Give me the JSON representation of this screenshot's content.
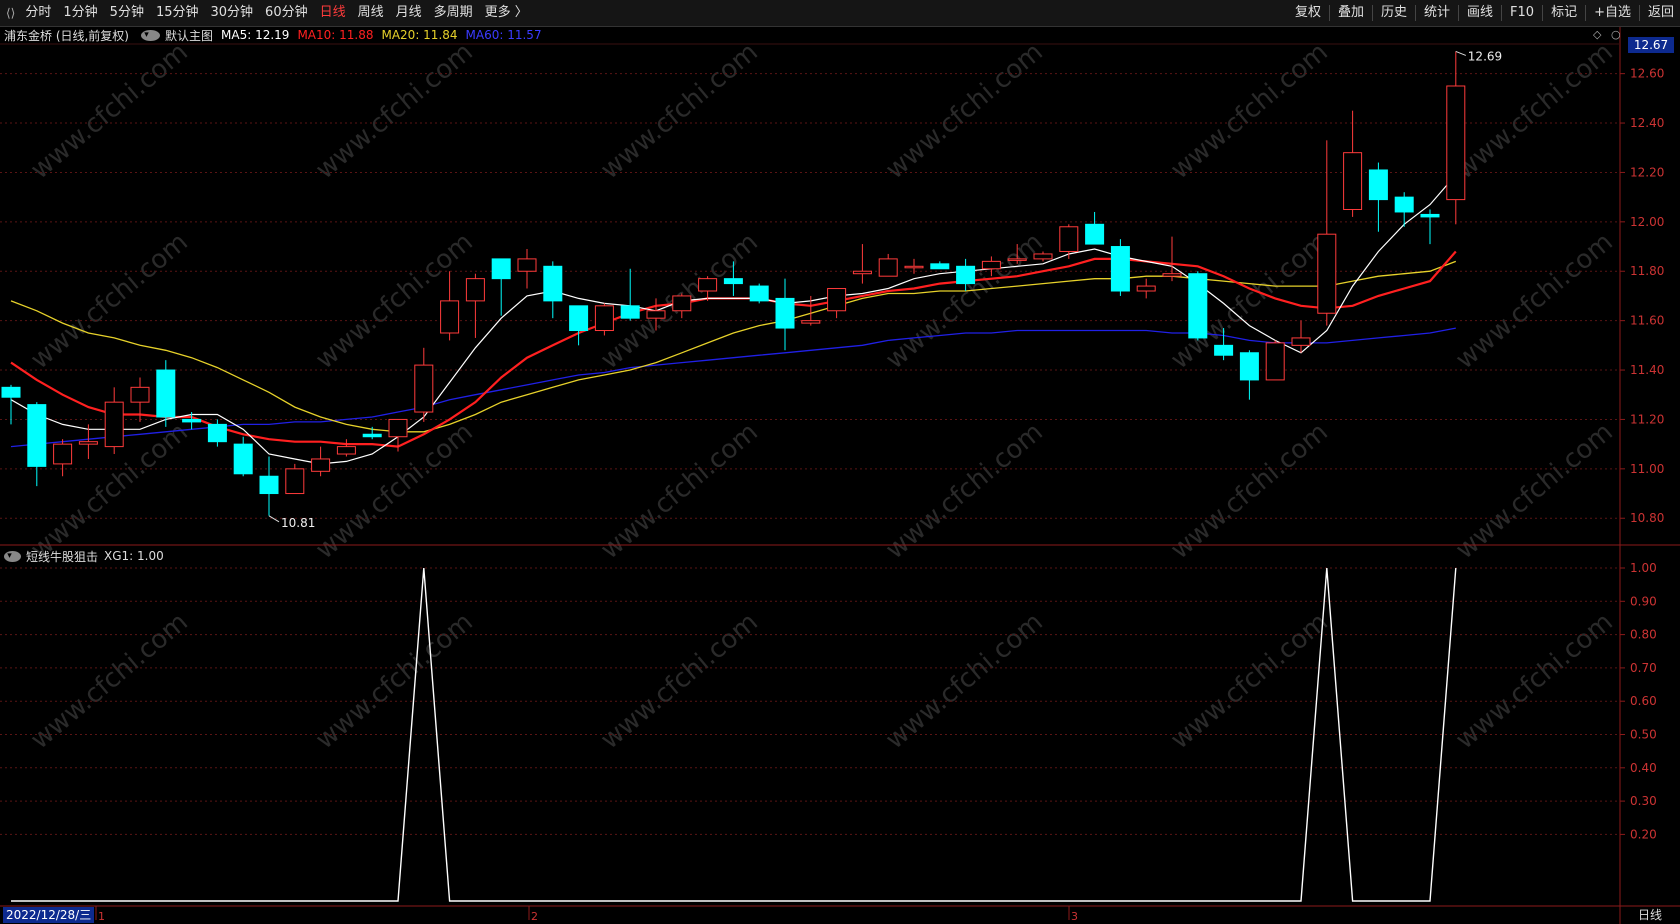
{
  "toolbar": {
    "periods": [
      "分时",
      "1分钟",
      "5分钟",
      "15分钟",
      "30分钟",
      "60分钟",
      "日线",
      "周线",
      "月线",
      "多周期",
      "更多 〉"
    ],
    "active_period": "日线",
    "tools": [
      "复权",
      "叠加",
      "历史",
      "统计",
      "画线",
      "F10",
      "标记",
      "+自选",
      "返回"
    ]
  },
  "main": {
    "stock_title": "浦东金桥 (日线,前复权)",
    "template": "默认主图",
    "ma5": "MA5: 12.19",
    "ma10": "MA10: 11.88",
    "ma20": "MA20: 11.84",
    "ma60": "MA60: 11.57",
    "last_price": "12.67",
    "high_label": "12.69",
    "low_label": "10.81",
    "colors": {
      "up": "#ff3b3b",
      "down": "#00ffff",
      "ma5": "#ffffff",
      "ma10": "#ff2020",
      "ma20": "#e6d12a",
      "ma60": "#2020e6"
    }
  },
  "sub": {
    "indicator": "短线牛股狙击",
    "xg1": "XG1: 1.00"
  },
  "footer": {
    "date": "2022/12/28/三",
    "period": "日线",
    "month_marks": [
      "1",
      "2",
      "3"
    ]
  },
  "watermark": "www.cfchi.com",
  "chart_data": [
    {
      "type": "candlestick",
      "title": "浦东金桥 (日线,前复权)",
      "ylim": [
        10.72,
        12.72
      ],
      "y_ticks": [
        10.8,
        11.0,
        11.2,
        11.4,
        11.6,
        11.8,
        12.0,
        12.2,
        12.4,
        12.6
      ],
      "candles": [
        {
          "o": 11.33,
          "h": 11.34,
          "l": 11.18,
          "c": 11.29
        },
        {
          "o": 11.26,
          "h": 11.27,
          "l": 10.93,
          "c": 11.01
        },
        {
          "o": 11.02,
          "h": 11.12,
          "l": 10.97,
          "c": 11.1
        },
        {
          "o": 11.1,
          "h": 11.18,
          "l": 11.04,
          "c": 11.11
        },
        {
          "o": 11.09,
          "h": 11.33,
          "l": 11.06,
          "c": 11.27
        },
        {
          "o": 11.27,
          "h": 11.37,
          "l": 11.19,
          "c": 11.33
        },
        {
          "o": 11.4,
          "h": 11.44,
          "l": 11.17,
          "c": 11.21
        },
        {
          "o": 11.2,
          "h": 11.23,
          "l": 11.16,
          "c": 11.19
        },
        {
          "o": 11.18,
          "h": 11.2,
          "l": 11.09,
          "c": 11.11
        },
        {
          "o": 11.1,
          "h": 11.13,
          "l": 10.97,
          "c": 10.98
        },
        {
          "o": 10.97,
          "h": 11.05,
          "l": 10.81,
          "c": 10.9
        },
        {
          "o": 10.9,
          "h": 11.02,
          "l": 10.9,
          "c": 11.0
        },
        {
          "o": 10.99,
          "h": 11.09,
          "l": 10.97,
          "c": 11.04
        },
        {
          "o": 11.06,
          "h": 11.12,
          "l": 11.05,
          "c": 11.09
        },
        {
          "o": 11.14,
          "h": 11.17,
          "l": 11.12,
          "c": 11.13
        },
        {
          "o": 11.13,
          "h": 11.2,
          "l": 11.07,
          "c": 11.2
        },
        {
          "o": 11.23,
          "h": 11.49,
          "l": 11.19,
          "c": 11.42
        },
        {
          "o": 11.55,
          "h": 11.8,
          "l": 11.52,
          "c": 11.68
        },
        {
          "o": 11.68,
          "h": 11.79,
          "l": 11.53,
          "c": 11.77
        },
        {
          "o": 11.85,
          "h": 11.85,
          "l": 11.62,
          "c": 11.77
        },
        {
          "o": 11.8,
          "h": 11.89,
          "l": 11.73,
          "c": 11.85
        },
        {
          "o": 11.82,
          "h": 11.84,
          "l": 11.61,
          "c": 11.68
        },
        {
          "o": 11.66,
          "h": 11.66,
          "l": 11.5,
          "c": 11.56
        },
        {
          "o": 11.56,
          "h": 11.67,
          "l": 11.54,
          "c": 11.66
        },
        {
          "o": 11.66,
          "h": 11.81,
          "l": 11.6,
          "c": 11.61
        },
        {
          "o": 11.61,
          "h": 11.69,
          "l": 11.56,
          "c": 11.64
        },
        {
          "o": 11.64,
          "h": 11.71,
          "l": 11.61,
          "c": 11.7
        },
        {
          "o": 11.72,
          "h": 11.78,
          "l": 11.68,
          "c": 11.77
        },
        {
          "o": 11.77,
          "h": 11.84,
          "l": 11.7,
          "c": 11.75
        },
        {
          "o": 11.74,
          "h": 11.75,
          "l": 11.67,
          "c": 11.68
        },
        {
          "o": 11.69,
          "h": 11.77,
          "l": 11.48,
          "c": 11.57
        },
        {
          "o": 11.59,
          "h": 11.7,
          "l": 11.58,
          "c": 11.6
        },
        {
          "o": 11.64,
          "h": 11.72,
          "l": 11.61,
          "c": 11.73
        },
        {
          "o": 11.79,
          "h": 11.91,
          "l": 11.75,
          "c": 11.8
        },
        {
          "o": 11.78,
          "h": 11.87,
          "l": 11.78,
          "c": 11.85
        },
        {
          "o": 11.82,
          "h": 11.85,
          "l": 11.79,
          "c": 11.82
        },
        {
          "o": 11.83,
          "h": 11.84,
          "l": 11.82,
          "c": 11.81
        },
        {
          "o": 11.82,
          "h": 11.85,
          "l": 11.72,
          "c": 11.75
        },
        {
          "o": 11.81,
          "h": 11.86,
          "l": 11.78,
          "c": 11.84
        },
        {
          "o": 11.85,
          "h": 11.91,
          "l": 11.83,
          "c": 11.85
        },
        {
          "o": 11.85,
          "h": 11.88,
          "l": 11.84,
          "c": 11.87
        },
        {
          "o": 11.88,
          "h": 11.99,
          "l": 11.85,
          "c": 11.98
        },
        {
          "o": 11.99,
          "h": 12.04,
          "l": 11.91,
          "c": 11.91
        },
        {
          "o": 11.9,
          "h": 11.93,
          "l": 11.7,
          "c": 11.72
        },
        {
          "o": 11.72,
          "h": 11.77,
          "l": 11.69,
          "c": 11.74
        },
        {
          "o": 11.78,
          "h": 11.94,
          "l": 11.76,
          "c": 11.79
        },
        {
          "o": 11.79,
          "h": 11.8,
          "l": 11.52,
          "c": 11.53
        },
        {
          "o": 11.5,
          "h": 11.57,
          "l": 11.44,
          "c": 11.46
        },
        {
          "o": 11.47,
          "h": 11.48,
          "l": 11.28,
          "c": 11.36
        },
        {
          "o": 11.36,
          "h": 11.52,
          "l": 11.36,
          "c": 11.51
        },
        {
          "o": 11.5,
          "h": 11.6,
          "l": 11.47,
          "c": 11.53
        },
        {
          "o": 11.63,
          "h": 12.33,
          "l": 11.58,
          "c": 11.95
        },
        {
          "o": 12.05,
          "h": 12.45,
          "l": 12.02,
          "c": 12.28
        },
        {
          "o": 12.21,
          "h": 12.24,
          "l": 11.96,
          "c": 12.09
        },
        {
          "o": 12.1,
          "h": 12.12,
          "l": 11.98,
          "c": 12.04
        },
        {
          "o": 12.03,
          "h": 12.05,
          "l": 11.91,
          "c": 12.02
        },
        {
          "o": 12.09,
          "h": 12.69,
          "l": 11.99,
          "c": 12.55
        }
      ],
      "ma5": [
        11.28,
        11.22,
        11.18,
        11.16,
        11.16,
        11.16,
        11.2,
        11.22,
        11.22,
        11.16,
        11.06,
        11.04,
        11.02,
        11.03,
        11.06,
        11.13,
        11.21,
        11.35,
        11.49,
        11.61,
        11.7,
        11.72,
        11.69,
        11.67,
        11.66,
        11.64,
        11.68,
        11.69,
        11.69,
        11.69,
        11.67,
        11.68,
        11.7,
        11.71,
        11.73,
        11.77,
        11.79,
        11.8,
        11.81,
        11.82,
        11.83,
        11.87,
        11.89,
        11.86,
        11.84,
        11.82,
        11.75,
        11.67,
        11.58,
        11.52,
        11.47,
        11.56,
        11.74,
        11.88,
        11.99,
        12.07,
        12.19
      ],
      "ma10": [
        11.43,
        11.36,
        11.3,
        11.25,
        11.22,
        11.22,
        11.21,
        11.21,
        11.17,
        11.14,
        11.12,
        11.11,
        11.11,
        11.1,
        11.1,
        11.09,
        11.14,
        11.2,
        11.27,
        11.37,
        11.45,
        11.5,
        11.55,
        11.59,
        11.63,
        11.66,
        11.67,
        11.69,
        11.69,
        11.69,
        11.67,
        11.66,
        11.68,
        11.7,
        11.72,
        11.73,
        11.75,
        11.76,
        11.77,
        11.78,
        11.8,
        11.82,
        11.85,
        11.85,
        11.84,
        11.83,
        11.82,
        11.78,
        11.73,
        11.69,
        11.66,
        11.65,
        11.66,
        11.7,
        11.73,
        11.76,
        11.88
      ],
      "ma20": [
        11.68,
        11.64,
        11.59,
        11.55,
        11.53,
        11.5,
        11.48,
        11.45,
        11.41,
        11.36,
        11.31,
        11.25,
        11.21,
        11.18,
        11.16,
        11.15,
        11.15,
        11.18,
        11.22,
        11.27,
        11.3,
        11.33,
        11.36,
        11.38,
        11.4,
        11.43,
        11.47,
        11.51,
        11.55,
        11.58,
        11.6,
        11.63,
        11.66,
        11.69,
        11.71,
        11.71,
        11.72,
        11.72,
        11.73,
        11.74,
        11.75,
        11.76,
        11.77,
        11.77,
        11.78,
        11.78,
        11.77,
        11.76,
        11.75,
        11.74,
        11.74,
        11.74,
        11.76,
        11.78,
        11.79,
        11.8,
        11.84
      ],
      "ma60": [
        11.09,
        11.1,
        11.11,
        11.12,
        11.13,
        11.14,
        11.15,
        11.16,
        11.17,
        11.18,
        11.18,
        11.19,
        11.19,
        11.2,
        11.21,
        11.23,
        11.25,
        11.28,
        11.3,
        11.32,
        11.34,
        11.36,
        11.38,
        11.39,
        11.41,
        11.42,
        11.43,
        11.44,
        11.45,
        11.46,
        11.47,
        11.48,
        11.49,
        11.5,
        11.52,
        11.53,
        11.54,
        11.55,
        11.55,
        11.56,
        11.56,
        11.56,
        11.56,
        11.56,
        11.56,
        11.55,
        11.55,
        11.54,
        11.52,
        11.51,
        11.51,
        11.51,
        11.52,
        11.53,
        11.54,
        11.55,
        11.57
      ]
    },
    {
      "type": "line",
      "title": "短线牛股狙击 XG1",
      "ylim": [
        0,
        1.0
      ],
      "y_ticks": [
        0.2,
        0.3,
        0.4,
        0.5,
        0.6,
        0.7,
        0.8,
        0.9,
        1.0
      ],
      "signal_indices": [
        16,
        51,
        56
      ],
      "values_count": 57
    }
  ]
}
